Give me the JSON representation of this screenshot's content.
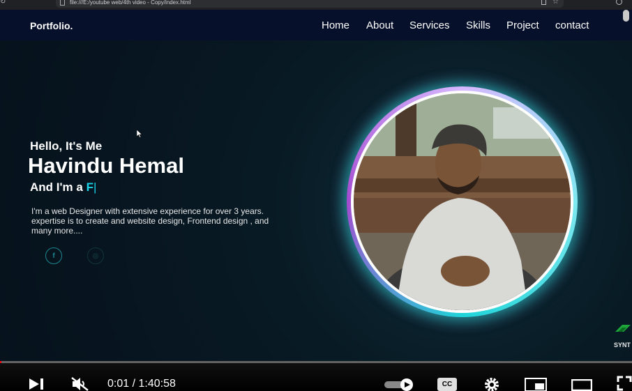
{
  "browser": {
    "address": "file:///E:/youtube web/4th video - Copy/index.html"
  },
  "site": {
    "logo": "Portfolio.",
    "nav": [
      {
        "label": "Home"
      },
      {
        "label": "About"
      },
      {
        "label": "Services"
      },
      {
        "label": "Skills"
      },
      {
        "label": "Project"
      },
      {
        "label": "contact"
      }
    ],
    "hero": {
      "greeting": "Hello, It's Me",
      "name": "Havindu Hemal",
      "role_prefix": "And I'm a ",
      "role_typed": "F",
      "description": "I'm a web Designer with extensive experience for over 3 years. expertise is to create and website design, Frontend design , and many more....",
      "socials": [
        {
          "icon": "facebook-icon",
          "glyph": "f"
        },
        {
          "icon": "instagram-icon",
          "glyph": "◎"
        }
      ]
    },
    "accent_color": "#19d3e8"
  },
  "watermark": {
    "text": "SYNT"
  },
  "player": {
    "current_time": "0:01",
    "separator": " / ",
    "duration": "1:40:58",
    "progress_fraction": 0.0002,
    "cc_label": "CC"
  }
}
